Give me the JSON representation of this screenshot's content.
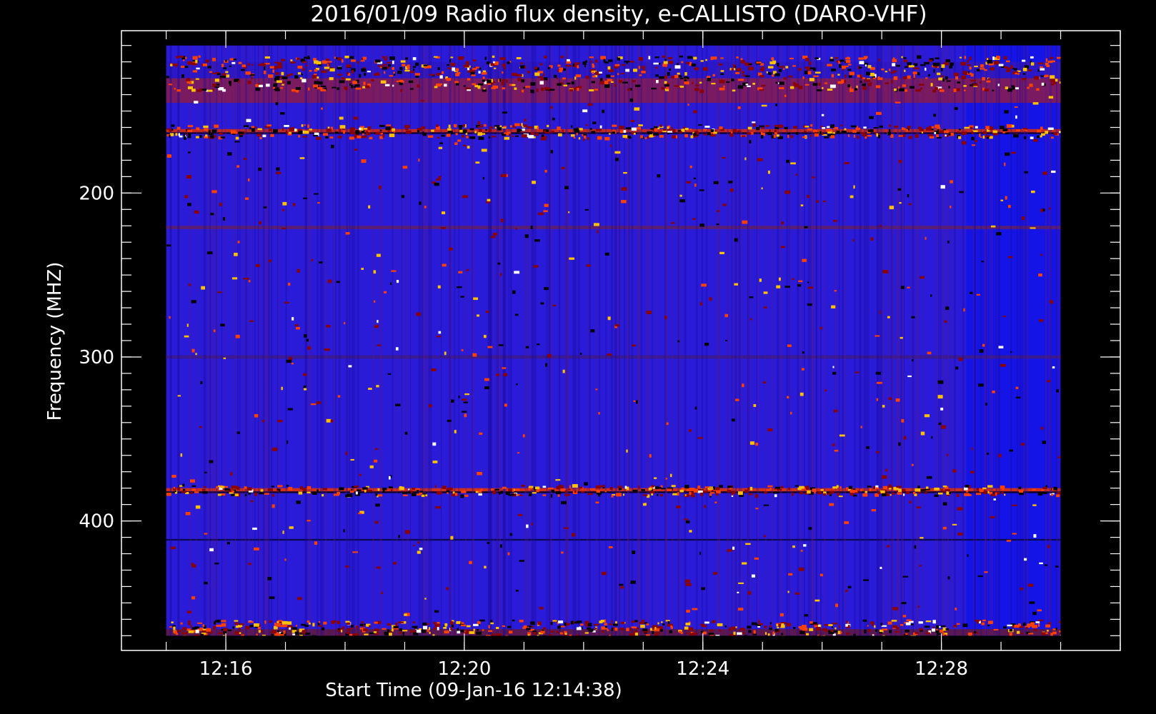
{
  "chart_data": {
    "type": "heatmap",
    "title": "2016/01/09  Radio flux density, e-CALLISTO (DARO-VHF)",
    "xlabel": "Start Time (09-Jan-16 12:14:38)",
    "ylabel": "Frequency (MHZ)",
    "x_axis": {
      "unit": "time",
      "range": [
        "12:14:15",
        "12:31:00"
      ],
      "data_range": [
        "12:15:00",
        "12:30:00"
      ],
      "ticks": [
        {
          "value": "12:16",
          "label": "12:16"
        },
        {
          "value": "12:20",
          "label": "12:20"
        },
        {
          "value": "12:24",
          "label": "12:24"
        },
        {
          "value": "12:28",
          "label": "12:28"
        }
      ],
      "minor_tick_minutes": 1
    },
    "y_axis": {
      "unit": "MHz",
      "direction": "inverted",
      "range": [
        101,
        479
      ],
      "data_range": [
        110,
        470
      ],
      "ticks": [
        {
          "value": 200,
          "label": "200"
        },
        {
          "value": 300,
          "label": "300"
        },
        {
          "value": 400,
          "label": "400"
        }
      ],
      "minor_tick_step": 10
    },
    "colormap": [
      "#000000",
      "#0000ff",
      "#8b0000",
      "#ff4000",
      "#ffc000",
      "#ffffff"
    ],
    "background_color": "#2a1bd8",
    "regions": [
      {
        "t_start": "12:28:25",
        "t_end": "12:30:00",
        "f_min": 110,
        "f_max": 470,
        "color": "#1414e6"
      }
    ],
    "bands": [
      {
        "f_min": 120,
        "f_max": 130,
        "color": "#2a18c8"
      },
      {
        "f_min": 130,
        "f_max": 145,
        "color": "#7a1a60"
      },
      {
        "f_min": 161,
        "f_max": 163,
        "color": "#c22a20"
      },
      {
        "f_min": 163,
        "f_max": 164,
        "color": "#110033"
      },
      {
        "f_min": 220,
        "f_max": 222,
        "color": "#5a1e70"
      },
      {
        "f_min": 299,
        "f_max": 301,
        "color": "#3a1a90"
      },
      {
        "f_min": 380,
        "f_max": 382,
        "color": "#d03018"
      },
      {
        "f_min": 382,
        "f_max": 383,
        "color": "#100022"
      },
      {
        "f_min": 411,
        "f_max": 412,
        "color": "#0a0a50"
      },
      {
        "f_min": 466,
        "f_max": 470,
        "color": "#5a1850"
      }
    ]
  }
}
